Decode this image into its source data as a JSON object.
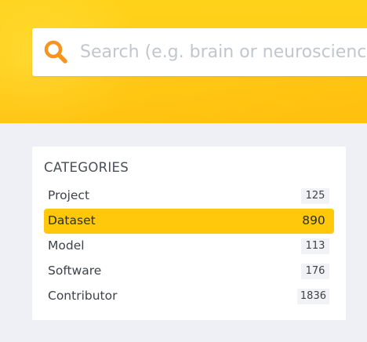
{
  "search": {
    "placeholder": "Search (e.g. brain or neuroscience)",
    "value": "",
    "icon": "search-icon",
    "icon_color": "#f7941d"
  },
  "colors": {
    "hero": "#ffd21a",
    "accent": "#ffc80a",
    "background": "#eef0f6"
  },
  "categories": {
    "title": "CATEGORIES",
    "selected": "Dataset",
    "items": [
      {
        "label": "Project",
        "count": "125"
      },
      {
        "label": "Dataset",
        "count": "890"
      },
      {
        "label": "Model",
        "count": "113"
      },
      {
        "label": "Software",
        "count": "176"
      },
      {
        "label": "Contributor",
        "count": "1836"
      }
    ]
  }
}
